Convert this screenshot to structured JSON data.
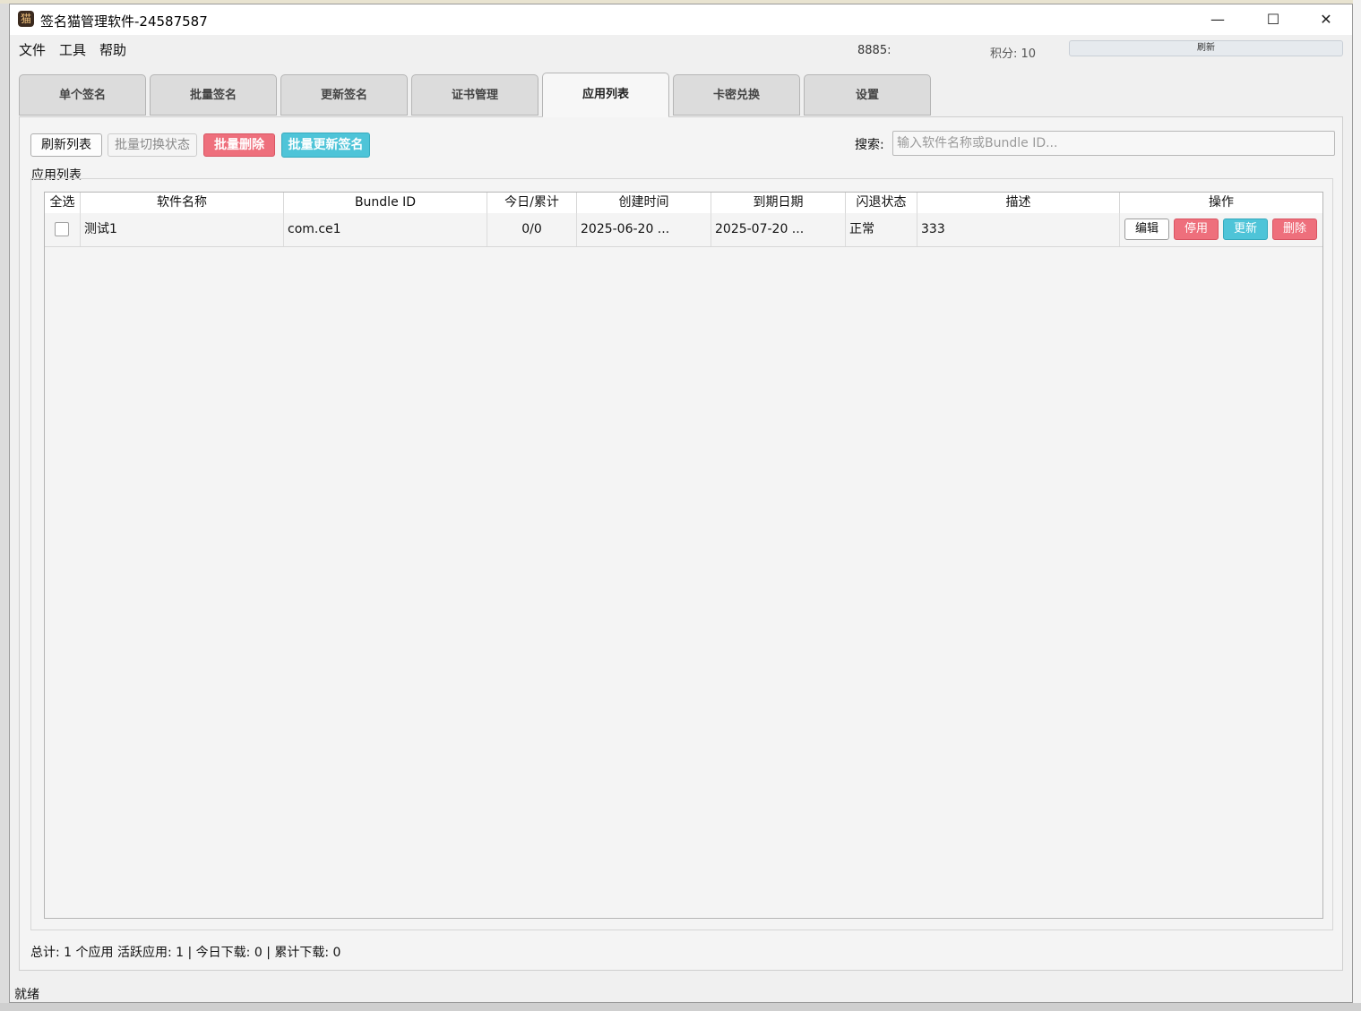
{
  "window": {
    "title": "签名猫管理软件-24587587",
    "controls": {
      "minimize": "—",
      "maximize": "☐",
      "close": "✕"
    }
  },
  "menu": [
    "文件",
    "工具",
    "帮助"
  ],
  "header_info": {
    "user_id": "8885:",
    "points": "积分: 10",
    "refresh_label": "刷新"
  },
  "tabs": [
    {
      "label": "单个签名",
      "active": false
    },
    {
      "label": "批量签名",
      "active": false
    },
    {
      "label": "更新签名",
      "active": false
    },
    {
      "label": "证书管理",
      "active": false
    },
    {
      "label": "应用列表",
      "active": true
    },
    {
      "label": "卡密兑换",
      "active": false
    },
    {
      "label": "设置",
      "active": false
    }
  ],
  "toolbar": {
    "refresh_list": "刷新列表",
    "batch_toggle": "批量切换状态",
    "batch_delete": "批量删除",
    "batch_update": "批量更新签名",
    "search_label": "搜索:",
    "search_placeholder": "输入软件名称或Bundle ID...",
    "search_value": ""
  },
  "group_title": "应用列表",
  "table": {
    "columns": [
      "全选",
      "软件名称",
      "Bundle ID",
      "今日/累计",
      "创建时间",
      "到期日期",
      "闪退状态",
      "描述",
      "操作"
    ],
    "rows": [
      {
        "name": "测试1",
        "bundle_id": "com.ce1",
        "downloads": "0/0",
        "created": "2025-06-20 ...",
        "expires": "2025-07-20 ...",
        "crash_status": "正常",
        "description": "333",
        "checked": false,
        "actions": {
          "edit": "编辑",
          "disable": "停用",
          "update": "更新",
          "delete": "删除"
        }
      }
    ]
  },
  "summary": "总计: 1 个应用  活跃应用: 1 | 今日下载: 0 | 累计下载: 0",
  "status": "就绪",
  "colors": {
    "danger": "#ee6f7c",
    "info": "#4ec4d8",
    "background": "#f0f0f0"
  }
}
